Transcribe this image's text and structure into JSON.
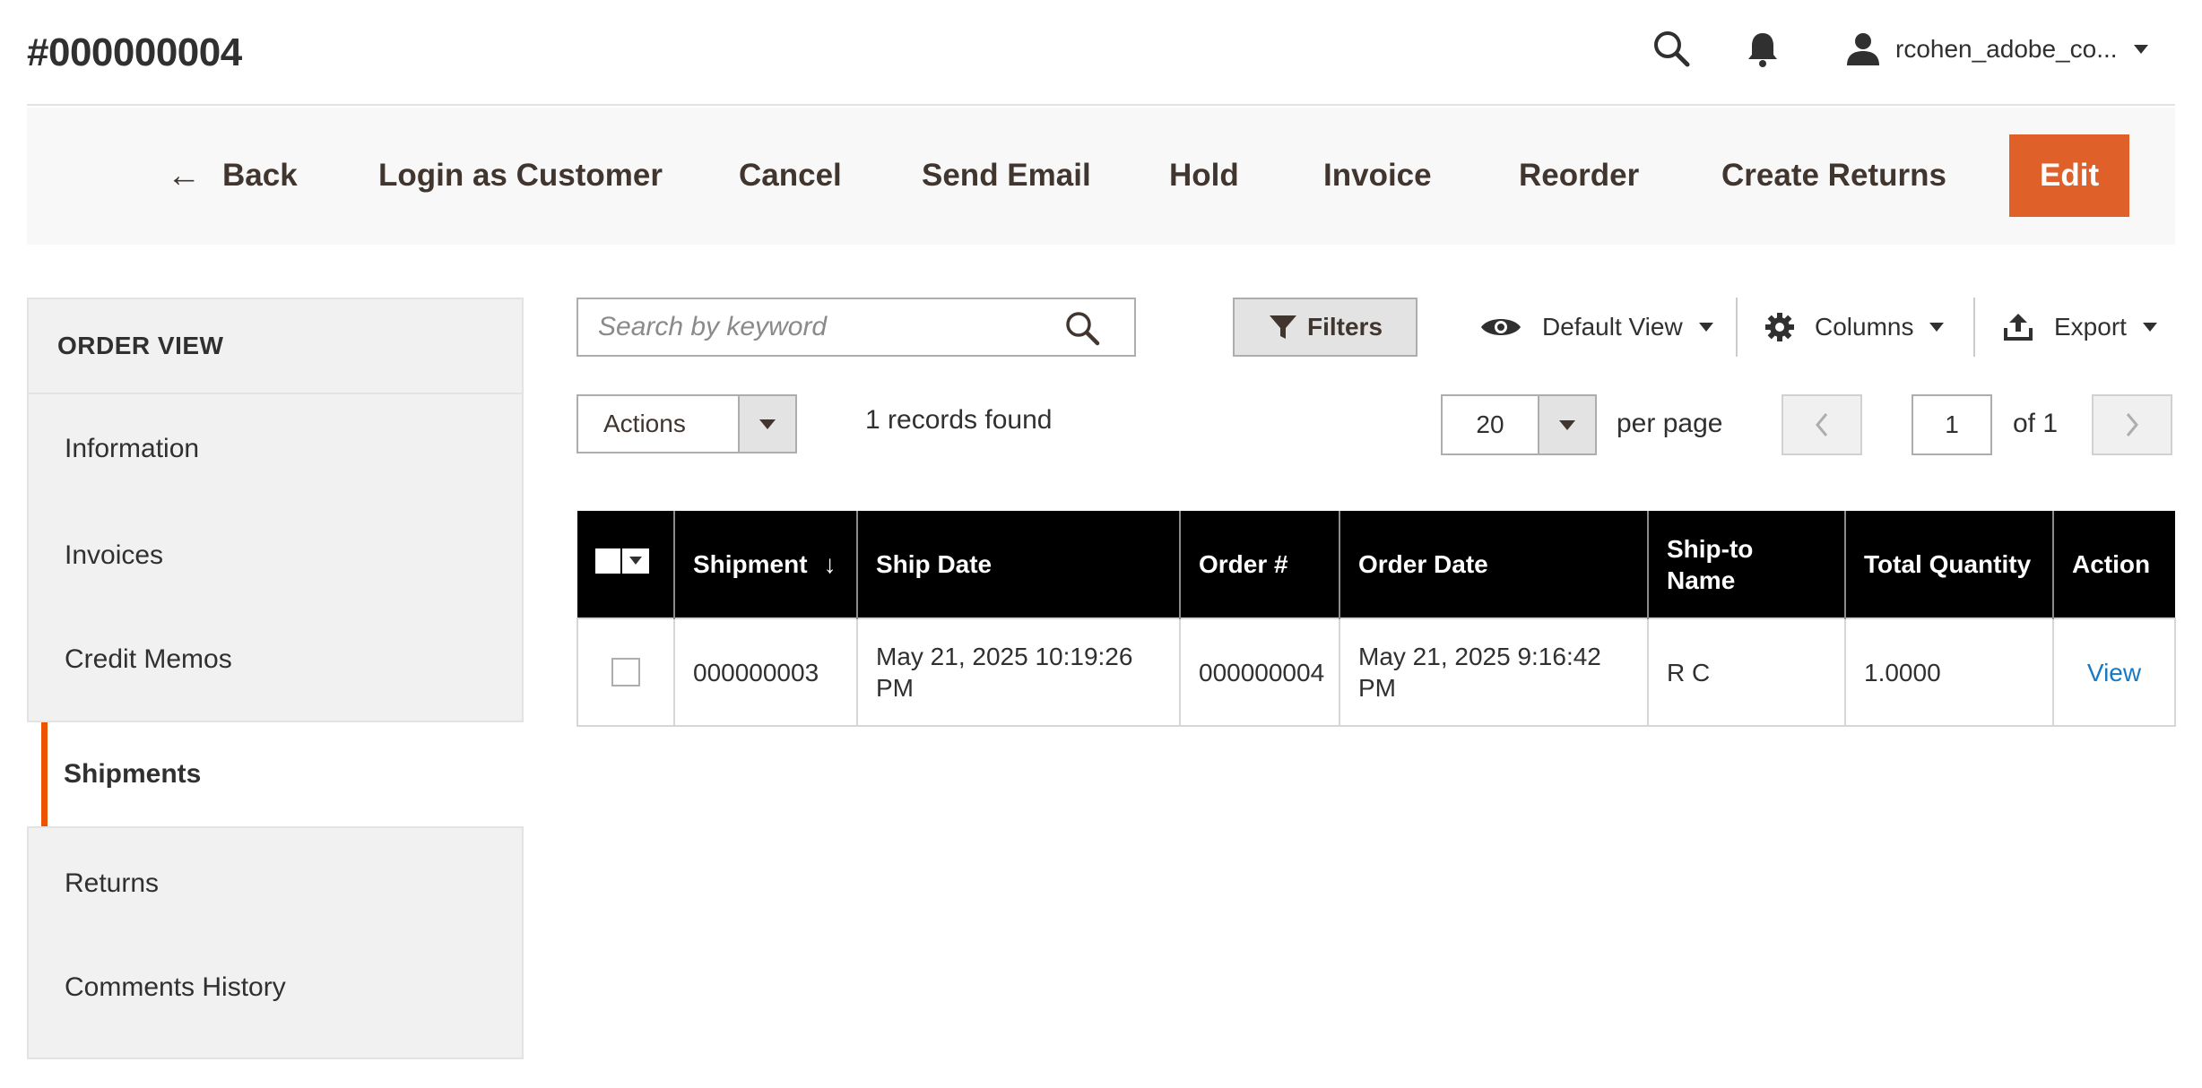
{
  "header": {
    "page_title": "#000000004",
    "user_name": "rcohen_adobe_co..."
  },
  "toolbar": {
    "back": "Back",
    "login_as_customer": "Login as Customer",
    "cancel": "Cancel",
    "send_email": "Send Email",
    "hold": "Hold",
    "invoice": "Invoice",
    "reorder": "Reorder",
    "create_returns": "Create Returns",
    "edit": "Edit"
  },
  "sidebar": {
    "title": "ORDER VIEW",
    "items": [
      {
        "label": "Information"
      },
      {
        "label": "Invoices"
      },
      {
        "label": "Credit Memos"
      },
      {
        "label": "Shipments",
        "active": true
      },
      {
        "label": "Returns"
      },
      {
        "label": "Comments History"
      }
    ]
  },
  "grid_controls": {
    "search_placeholder": "Search by keyword",
    "filters": "Filters",
    "default_view": "Default View",
    "columns": "Columns",
    "export": "Export",
    "actions": "Actions",
    "records_found": "1 records found",
    "per_page_value": "20",
    "per_page_label": "per page",
    "current_page": "1",
    "of_pages": "of 1"
  },
  "table": {
    "columns": [
      "Shipment",
      "Ship Date",
      "Order #",
      "Order Date",
      "Ship-to Name",
      "Total Quantity",
      "Action"
    ],
    "sort_indicator": "↓",
    "rows": [
      {
        "shipment": "000000003",
        "ship_date": "May 21, 2025 10:19:26 PM",
        "order_number": "000000004",
        "order_date": "May 21, 2025 9:16:42 PM",
        "ship_to_name": "R C",
        "total_quantity": "1.0000",
        "action": "View"
      }
    ]
  },
  "colors": {
    "accent": "#eb5202",
    "edit_button": "#e0602a",
    "link": "#1979c3",
    "table_header": "#000000"
  },
  "icons": [
    "search-icon",
    "bell-icon",
    "user-icon",
    "back-arrow-icon",
    "filter-icon",
    "eye-icon",
    "gear-icon",
    "export-icon",
    "chevron-left-icon",
    "chevron-right-icon"
  ]
}
